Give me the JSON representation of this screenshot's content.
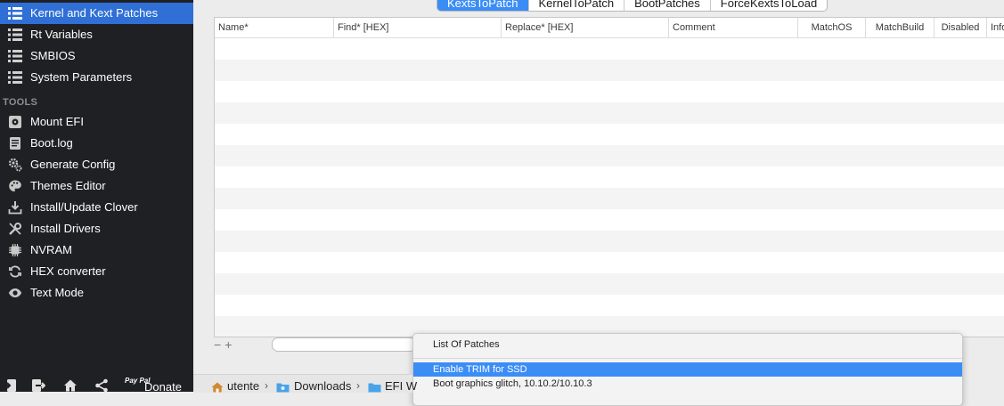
{
  "sidebar": {
    "items": [
      {
        "label": "Kernel and Kext Patches",
        "icon": "list-icon",
        "selected": true
      },
      {
        "label": "Rt Variables",
        "icon": "list-icon"
      },
      {
        "label": "SMBIOS",
        "icon": "list-icon"
      },
      {
        "label": "System Parameters",
        "icon": "list-icon"
      }
    ],
    "tools_heading": "TOOLS",
    "tools": [
      {
        "label": "Mount EFI",
        "icon": "disk-icon"
      },
      {
        "label": "Boot.log",
        "icon": "document-icon"
      },
      {
        "label": "Generate Config",
        "icon": "gears-icon"
      },
      {
        "label": "Themes Editor",
        "icon": "palette-icon"
      },
      {
        "label": "Install/Update Clover",
        "icon": "download-icon"
      },
      {
        "label": "Install Drivers",
        "icon": "wrench-icon"
      },
      {
        "label": "NVRAM",
        "icon": "chip-icon"
      },
      {
        "label": "HEX converter",
        "icon": "refresh-icon"
      },
      {
        "label": "Text Mode",
        "icon": "eye-icon"
      }
    ],
    "footer": {
      "icons": [
        "import-icon",
        "export-icon",
        "home-icon",
        "share-icon"
      ],
      "paypal_text": "Pay Pal",
      "donate_label": "Donate"
    }
  },
  "tabs": [
    {
      "label": "KextsToPatch",
      "active": true
    },
    {
      "label": "KernelToPatch"
    },
    {
      "label": "BootPatches"
    },
    {
      "label": "ForceKextsToLoad"
    }
  ],
  "table": {
    "columns": [
      "Name*",
      "Find* [HEX]",
      "Replace* [HEX]",
      "Comment",
      "MatchOS",
      "MatchBuild",
      "Disabled",
      "Info"
    ],
    "rows": []
  },
  "table_controls": {
    "minus": "−",
    "plus": "+"
  },
  "popup": {
    "title": "List Of Patches",
    "items": [
      {
        "label": "Enable TRIM for SSD",
        "selected": true
      },
      {
        "label": "Boot graphics glitch, 10.10.2/10.10.3"
      }
    ]
  },
  "pathbar": {
    "crumbs": [
      "utente",
      "Downloads",
      "EFI W"
    ]
  },
  "colors": {
    "accent": "#3b8df6",
    "sidebar_bg": "#1f2023",
    "sidebar_selected": "#2f6fd6"
  }
}
